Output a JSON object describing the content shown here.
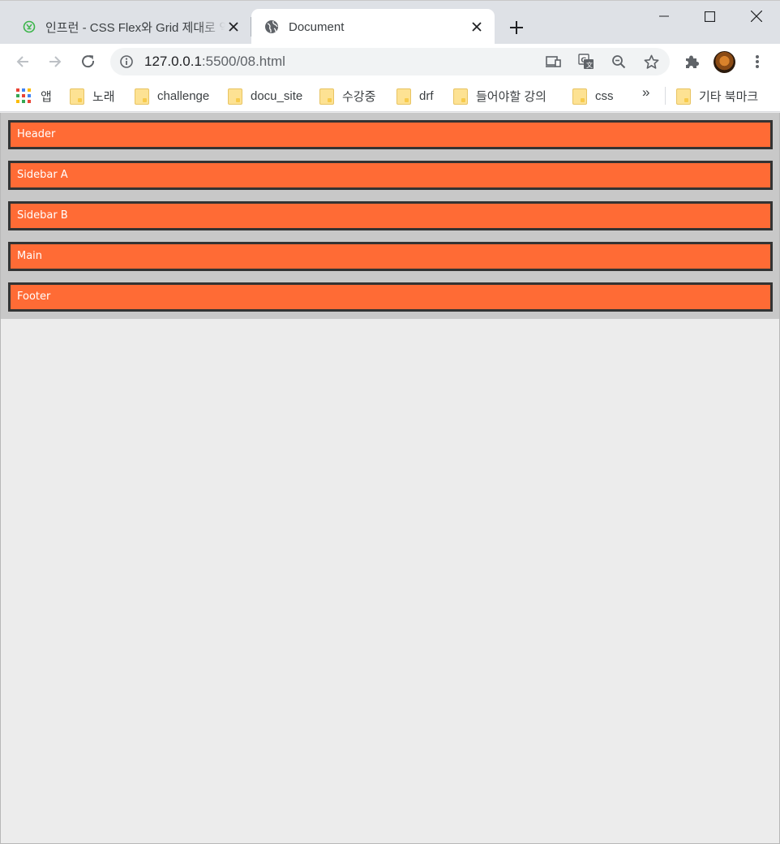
{
  "browser": {
    "tabs": [
      {
        "title": "인프런 - CSS Flex와 Grid 제대로 익히기",
        "active": false,
        "icon": "inflearn-icon"
      },
      {
        "title": "Document",
        "active": true,
        "icon": "globe-icon"
      }
    ],
    "url": {
      "host": "127.0.0.1",
      "rest": ":5500/08.html"
    },
    "bookmarks": [
      {
        "label": "앱",
        "icon": "apps-grid-icon"
      },
      {
        "label": "노래",
        "icon": "folder-icon"
      },
      {
        "label": "challenge",
        "icon": "folder-icon"
      },
      {
        "label": "docu_site",
        "icon": "folder-icon"
      },
      {
        "label": "수강중",
        "icon": "folder-icon"
      },
      {
        "label": "drf",
        "icon": "folder-icon"
      },
      {
        "label": "들어야할 강의",
        "icon": "folder-icon"
      },
      {
        "label": "css",
        "icon": "folder-icon"
      }
    ],
    "bookmarks_more": "»",
    "other_bookmarks": "기타 북마크"
  },
  "page": {
    "items": [
      "Header",
      "Sidebar A",
      "Sidebar B",
      "Main",
      "Footer"
    ],
    "colors": {
      "item_background": "#ff6b35",
      "item_border": "#333333",
      "container_background": "#c8c8c8"
    }
  }
}
